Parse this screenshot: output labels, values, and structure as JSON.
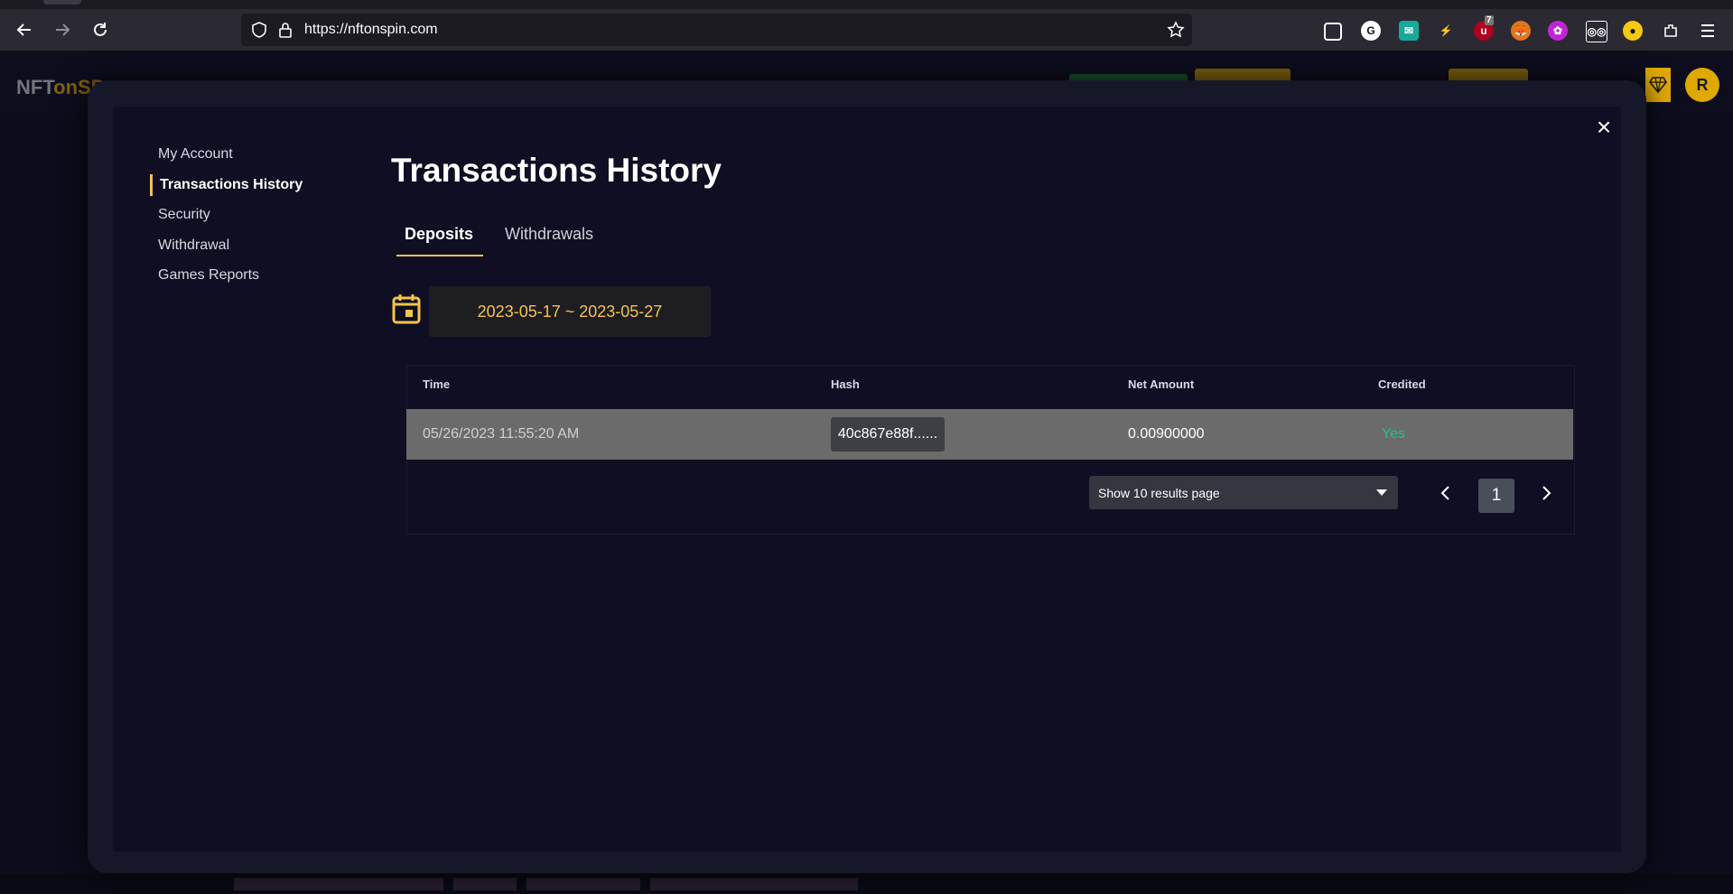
{
  "browser": {
    "url": "https://nftonspin.com",
    "extension_badge": "7",
    "extension_g_label": "G"
  },
  "site": {
    "brand_prefix": "NFT",
    "brand_on": "onSP",
    "avatar_initial": "R"
  },
  "modal": {
    "sidebar": [
      {
        "label": "My Account"
      },
      {
        "label": "Transactions History"
      },
      {
        "label": "Security"
      },
      {
        "label": "Withdrawal"
      },
      {
        "label": "Games Reports"
      }
    ],
    "title": "Transactions History",
    "tabs": [
      {
        "label": "Deposits"
      },
      {
        "label": "Withdrawals"
      }
    ],
    "date_range": "2023-05-17 ~ 2023-05-27",
    "table": {
      "headers": [
        "Time",
        "Hash",
        "Net Amount",
        "Credited"
      ],
      "rows": [
        {
          "time": "05/26/2023 11:55:20 AM",
          "hash": "40c867e88f......",
          "net_amount": "0.00900000",
          "credited": "Yes"
        }
      ]
    },
    "pagination": {
      "page_size_label": "Show 10 results page",
      "current_page": "1"
    },
    "close_symbol": "×"
  },
  "colors": {
    "accent": "#f5c34b",
    "credited_yes": "#1ec48e",
    "brand_gold": "#e0a900"
  }
}
